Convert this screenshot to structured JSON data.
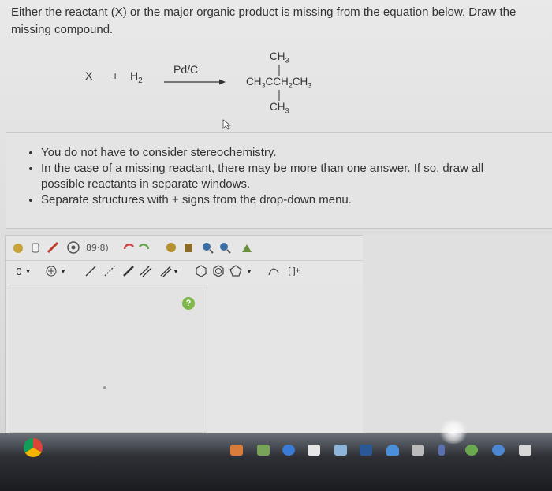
{
  "question": {
    "text": "Either the reactant (X) or the major organic product is missing from the equation below. Draw the missing compound."
  },
  "equation": {
    "reactant_x": "X",
    "plus": "+",
    "reagent": "H",
    "reagent_sub": "2",
    "catalyst": "Pd/C",
    "product": {
      "top_ch3": "CH3",
      "main_chain": "CH3CCH2CH3",
      "bottom_ch3": "CH3"
    }
  },
  "instructions": [
    "You do not have to consider stereochemistry.",
    "In the case of a missing reactant, there may be more than one answer. If so, draw all possible reactants in separate windows.",
    "Separate structures with + signs from the drop-down menu."
  ],
  "editor": {
    "charge_value": "0",
    "help_label": "?",
    "bracket_label": "[ ]±",
    "toolbar1_icons": [
      "hand-icon",
      "eraser-icon",
      "pencil-icon",
      "ring-template-icon",
      "charge-icon",
      "undo-icon",
      "redo-icon",
      "copy-icon",
      "paste-icon",
      "zoom-in-icon",
      "zoom-out-icon",
      "clean-icon"
    ],
    "toolbar2_icons": [
      "charge-dropdown",
      "add-atom-dropdown",
      "single-bond-tool",
      "bond-dash-tool",
      "double-bond-tool",
      "triple-bond-tool",
      "bond-dropdown",
      "hexagon-tool",
      "benzene-tool",
      "pentagon-tool",
      "ring-dropdown",
      "arrow-tool",
      "bracket-tool"
    ]
  },
  "taskbar": {
    "icons": [
      "chrome-icon",
      "photos-icon",
      "mail-icon",
      "safari-icon",
      "app-icon",
      "preview-icon",
      "word-icon",
      "drive-icon",
      "keyboard-icon",
      "bluetooth-icon",
      "maps-icon",
      "compass-icon",
      "trash-icon"
    ]
  }
}
